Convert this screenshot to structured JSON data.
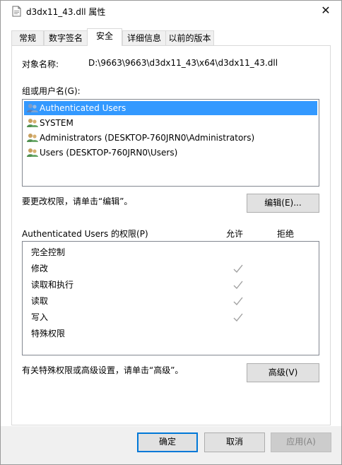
{
  "window": {
    "title": "d3dx11_43.dll 属性",
    "close_glyph": "✕"
  },
  "tabs": [
    {
      "label": "常规",
      "active": false
    },
    {
      "label": "数字签名",
      "active": false
    },
    {
      "label": "安全",
      "active": true
    },
    {
      "label": "详细信息",
      "active": false
    },
    {
      "label": "以前的版本",
      "active": false
    }
  ],
  "security": {
    "object_name_label": "对象名称:",
    "object_name_value": "D:\\9663\\9663\\d3dx11_43\\x64\\d3dx11_43.dll",
    "group_label": "组或用户名(G):",
    "users": [
      {
        "name": "Authenticated Users",
        "icon": "users-group-icon",
        "selected": true
      },
      {
        "name": "SYSTEM",
        "icon": "users-group-icon",
        "selected": false
      },
      {
        "name": "Administrators (DESKTOP-760JRN0\\Administrators)",
        "icon": "users-group-icon",
        "selected": false
      },
      {
        "name": "Users (DESKTOP-760JRN0\\Users)",
        "icon": "users-group-icon",
        "selected": false
      }
    ],
    "change_hint": "要更改权限，请单击“编辑”。",
    "edit_button": "编辑(E)...",
    "perm_header": "Authenticated Users 的权限(P)",
    "allow_header": "允许",
    "deny_header": "拒绝",
    "permissions": [
      {
        "name": "完全控制",
        "allow": false,
        "deny": false
      },
      {
        "name": "修改",
        "allow": true,
        "deny": false
      },
      {
        "name": "读取和执行",
        "allow": true,
        "deny": false
      },
      {
        "name": "读取",
        "allow": true,
        "deny": false
      },
      {
        "name": "写入",
        "allow": true,
        "deny": false
      },
      {
        "name": "特殊权限",
        "allow": false,
        "deny": false
      }
    ],
    "advanced_hint": "有关特殊权限或高级设置，请单击“高级”。",
    "advanced_button": "高级(V)"
  },
  "footer": {
    "ok": "确定",
    "cancel": "取消",
    "apply": "应用(A)",
    "apply_disabled": true
  },
  "colors": {
    "selection": "#3399ff",
    "primary_border": "#0078d7",
    "check_gray": "#a0a0a0"
  }
}
